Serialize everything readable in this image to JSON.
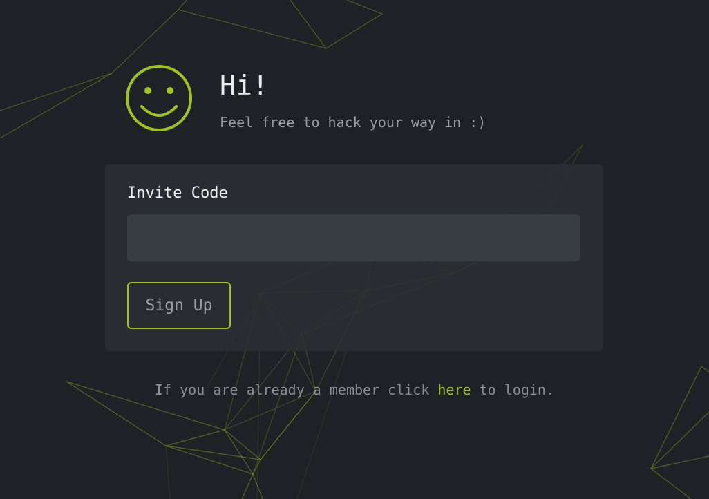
{
  "header": {
    "greeting": "Hi!",
    "tagline": "Feel free to hack your way in :)"
  },
  "form": {
    "invite_label": "Invite Code",
    "invite_value": "",
    "invite_placeholder": "",
    "signup_label": "Sign Up"
  },
  "footer": {
    "prefix": "If you are already a member click ",
    "link_text": "here",
    "suffix": " to login."
  },
  "icons": {
    "logo": "smiley-icon"
  },
  "colors": {
    "background": "#1e2126",
    "accent": "#9fc31d",
    "card": "#2c3035",
    "input": "#383d44",
    "heading_text": "#e8eaec",
    "muted_text": "#9a9ea3"
  }
}
